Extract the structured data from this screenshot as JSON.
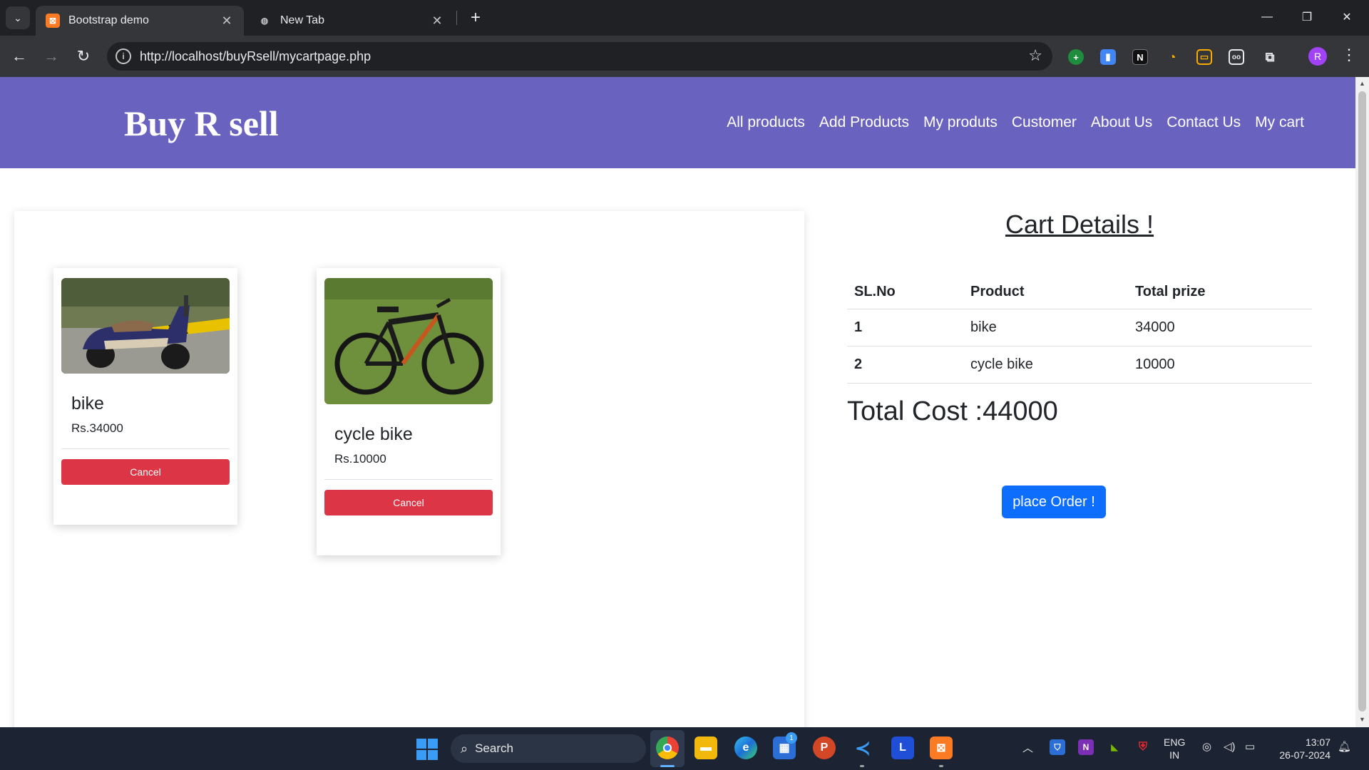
{
  "browser": {
    "tabs": [
      {
        "title": "Bootstrap demo",
        "favicon": "xampp-icon",
        "active": true
      },
      {
        "title": "New Tab",
        "favicon": "globe-icon",
        "active": false
      }
    ],
    "url": "http://localhost/buyRsell/mycartpage.php",
    "profile_initial": "R",
    "window_controls": {
      "minimize": "—",
      "restore": "❐",
      "close": "✕"
    }
  },
  "site": {
    "brand": "Buy R sell",
    "nav": [
      "All products",
      "Add Products",
      "My produts",
      "Customer",
      "About Us",
      "Contact Us",
      "My cart"
    ]
  },
  "cart_items": [
    {
      "name": "bike",
      "price": "Rs.34000",
      "cancel_label": "Cancel",
      "image": "scooter-photo"
    },
    {
      "name": "cycle bike",
      "price": "Rs.10000",
      "cancel_label": "Cancel",
      "image": "mountain-bike-photo"
    }
  ],
  "cart_details": {
    "title": "Cart Details !",
    "headers": [
      "SL.No",
      "Product",
      "Total prize"
    ],
    "rows": [
      {
        "sl": "1",
        "product": "bike",
        "total": "34000"
      },
      {
        "sl": "2",
        "product": "cycle bike",
        "total": "10000"
      }
    ],
    "total_cost": "Total Cost :44000",
    "place_order_label": "place Order !",
    "place_order_color": "#0d6efd"
  },
  "taskbar": {
    "search_label": "Search",
    "store_badge": "1",
    "lang_line1": "ENG",
    "lang_line2": "IN",
    "time": "13:07",
    "date": "26-07-2024"
  },
  "colors": {
    "navbar": "#6a62bf",
    "cancel_button": "#dc3545",
    "browser_dark": "#202124"
  }
}
